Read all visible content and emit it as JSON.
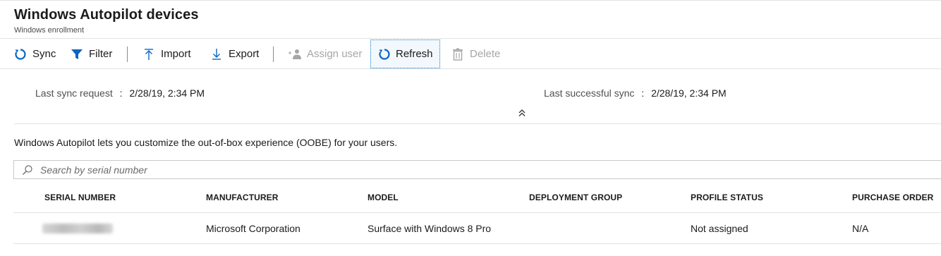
{
  "header": {
    "title": "Windows Autopilot devices",
    "subtitle": "Windows enrollment"
  },
  "toolbar": {
    "sync": "Sync",
    "filter": "Filter",
    "import": "Import",
    "export": "Export",
    "assign_user": "Assign user",
    "refresh": "Refresh",
    "delete": "Delete"
  },
  "sync_info": {
    "last_request_label": "Last sync request",
    "last_request_value": "2/28/19, 2:34 PM",
    "last_success_label": "Last successful sync",
    "last_success_value": "2/28/19, 2:34 PM",
    "separator": ":"
  },
  "info_text": "Windows Autopilot lets you customize the out-of-box experience (OOBE) for your users.",
  "search": {
    "placeholder": "Search by serial number",
    "value": ""
  },
  "table": {
    "columns": [
      "SERIAL NUMBER",
      "MANUFACTURER",
      "MODEL",
      "DEPLOYMENT GROUP",
      "PROFILE STATUS",
      "PURCHASE ORDER"
    ],
    "rows": [
      {
        "manufacturer": "Microsoft Corporation",
        "model": "Surface with Windows 8 Pro",
        "deployment_group": "",
        "profile_status": "Not assigned",
        "purchase_order": "N/A"
      }
    ]
  },
  "colors": {
    "accent": "#0a66c2",
    "text": "#1b1b1b",
    "disabled": "#a6a6a6",
    "border": "#e2e2e2"
  },
  "icons": {
    "sync": "sync-icon",
    "filter": "filter-icon",
    "import": "import-icon",
    "export": "export-icon",
    "assign_user": "assign-user-icon",
    "refresh": "refresh-icon",
    "delete": "trash-icon",
    "collapse": "double-chevron-up-icon",
    "search": "search-icon"
  }
}
